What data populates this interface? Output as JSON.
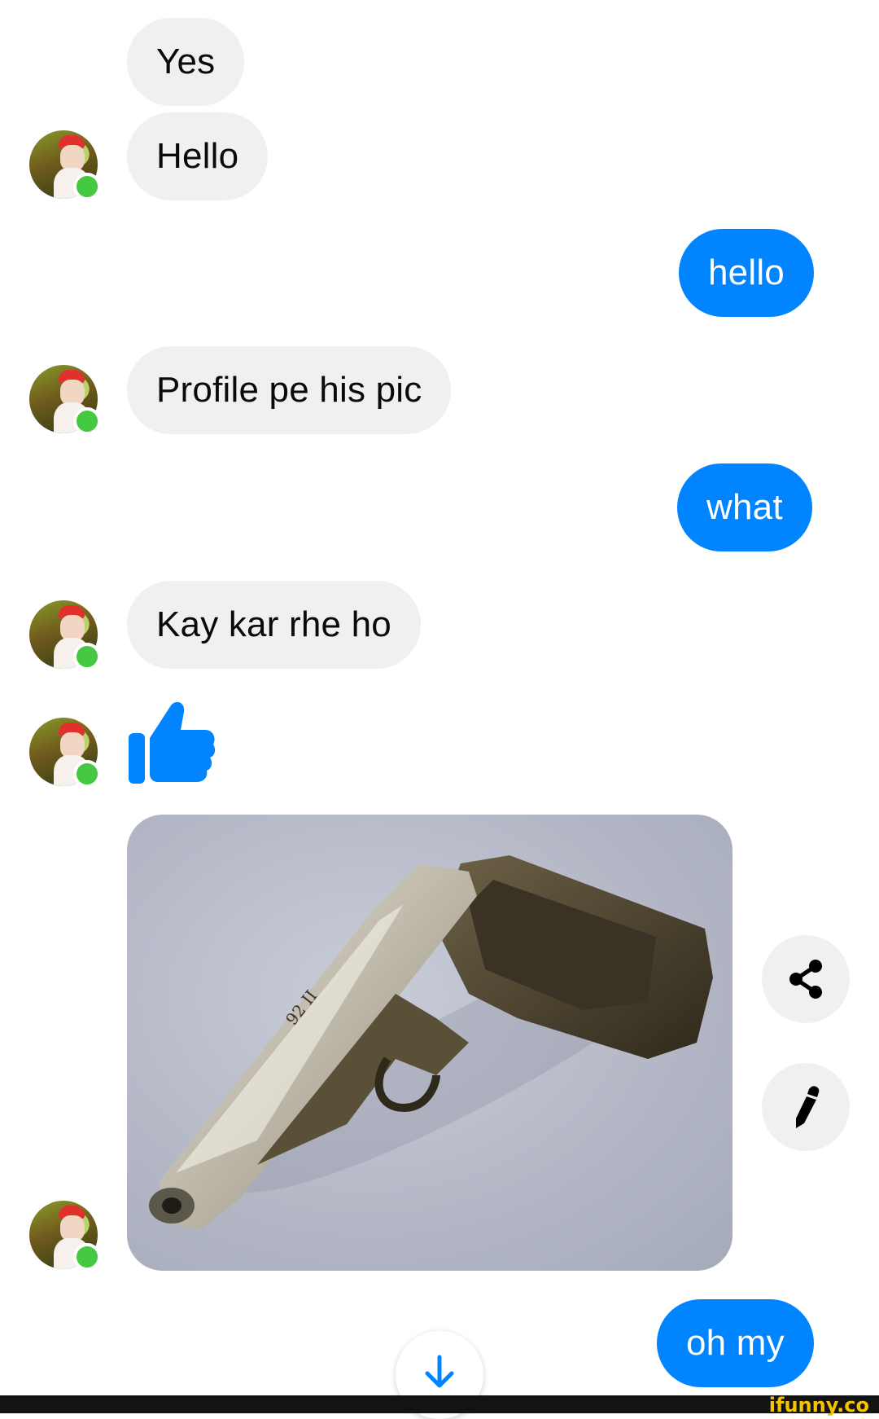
{
  "messages": {
    "m1": "Yes",
    "m2": "Hello",
    "m3": "hello",
    "m4": "Profile pe his pic",
    "m5": "what",
    "m6": "Kay kar rhe ho",
    "m7": "oh my"
  },
  "reactions": {
    "thumbs_up": "thumbs-up-icon"
  },
  "photo": {
    "engraving": "92 II"
  },
  "actions": {
    "share": "share-icon",
    "edit": "pencil-icon",
    "scroll": "arrow-down-icon"
  },
  "watermark": "ifunny.co",
  "colors": {
    "outgoing_bubble": "#0084ff",
    "incoming_bubble": "#f0f0f0",
    "online_dot": "#45c842",
    "watermark": "#f5c400"
  }
}
